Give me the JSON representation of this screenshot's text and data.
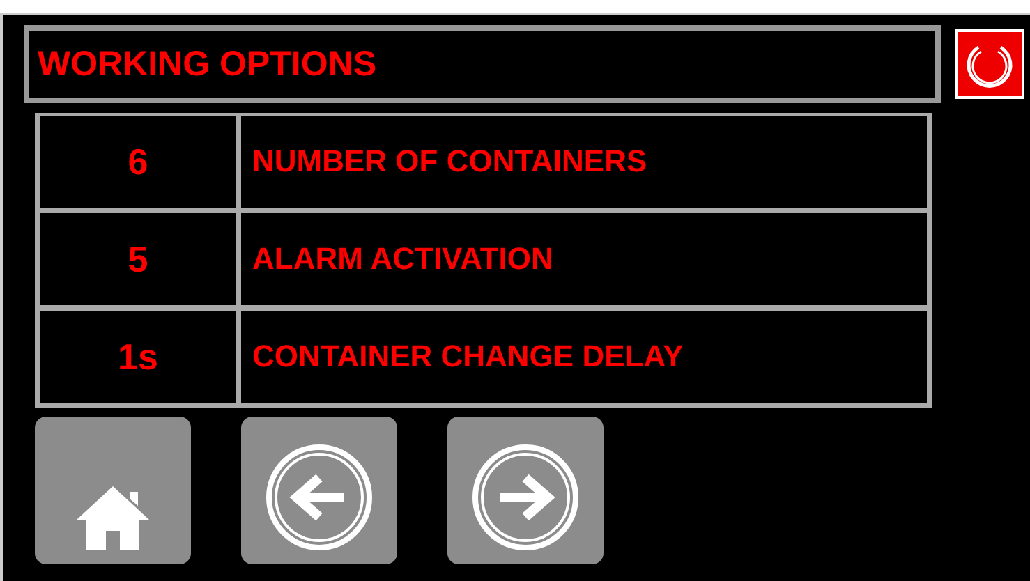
{
  "header": {
    "title": "WORKING OPTIONS"
  },
  "options": [
    {
      "value": "6",
      "label": "NUMBER OF CONTAINERS"
    },
    {
      "value": "5",
      "label": "ALARM ACTIVATION"
    },
    {
      "value": "1s",
      "label": "CONTAINER CHANGE DELAY"
    }
  ],
  "nav_buttons": [
    {
      "kind": "home"
    },
    {
      "kind": "back"
    },
    {
      "kind": "forward"
    }
  ]
}
